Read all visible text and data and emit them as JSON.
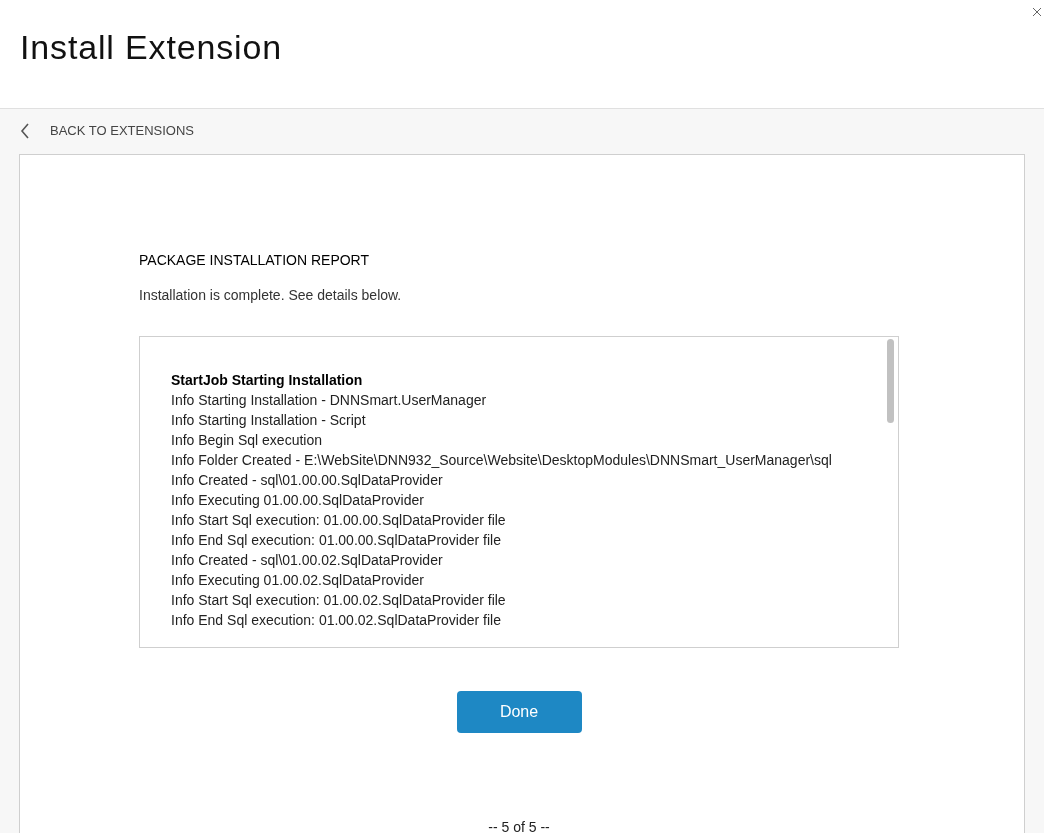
{
  "window": {
    "title": "Install Extension"
  },
  "back_link": {
    "label": "BACK TO EXTENSIONS"
  },
  "report": {
    "heading": "PACKAGE INSTALLATION REPORT",
    "message": "Installation is complete. See details below.",
    "log": [
      {
        "kind": "header",
        "text": "StartJob Starting Installation"
      },
      {
        "kind": "info",
        "text": "Info Starting Installation - DNNSmart.UserManager"
      },
      {
        "kind": "info",
        "text": "Info Starting Installation - Script"
      },
      {
        "kind": "info",
        "text": "Info Begin Sql execution"
      },
      {
        "kind": "info",
        "text": "Info Folder Created - E:\\WebSite\\DNN932_Source\\Website\\DesktopModules\\DNNSmart_UserManager\\sql"
      },
      {
        "kind": "info",
        "text": "Info Created - sql\\01.00.00.SqlDataProvider"
      },
      {
        "kind": "info",
        "text": "Info Executing 01.00.00.SqlDataProvider"
      },
      {
        "kind": "info",
        "text": "Info Start Sql execution: 01.00.00.SqlDataProvider file"
      },
      {
        "kind": "info",
        "text": "Info End Sql execution: 01.00.00.SqlDataProvider file"
      },
      {
        "kind": "info",
        "text": "Info Created - sql\\01.00.02.SqlDataProvider"
      },
      {
        "kind": "info",
        "text": "Info Executing 01.00.02.SqlDataProvider"
      },
      {
        "kind": "info",
        "text": "Info Start Sql execution: 01.00.02.SqlDataProvider file"
      },
      {
        "kind": "info",
        "text": "Info End Sql execution: 01.00.02.SqlDataProvider file"
      }
    ]
  },
  "done_button": "Done",
  "page_indicator": "-- 5 of 5 --"
}
